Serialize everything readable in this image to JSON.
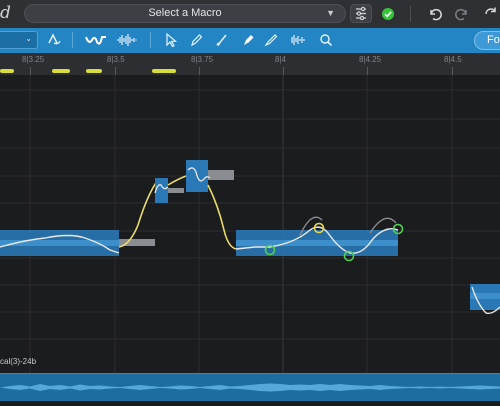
{
  "topbar": {
    "app_glyph": "d",
    "macro_placeholder": "Select a Macro"
  },
  "toolbar": {
    "format_label": "For"
  },
  "ruler": {
    "labels": [
      "8|3.25",
      "8|3.5",
      "8|3.75",
      "8|4",
      "8|4.25",
      "8|4.5"
    ]
  },
  "editor": {
    "status": "cal(3)-24b"
  },
  "colors": {
    "accent_blue": "#2485c4",
    "blob_blue": "#2a78b5",
    "pitch_line": "#e9e9e9",
    "transition_line": "#e9dc6a",
    "anchor_green": "#4ed14f",
    "anchor_yellow": "#e7d64a",
    "ruler_region": "#d9dd3a"
  },
  "icons": {
    "menu": "chevron-down-icon",
    "sliders": "sliders-icon",
    "ok": "check-circle-icon",
    "undo": "undo-icon",
    "redo": "redo-icon",
    "refresh": "refresh-icon"
  }
}
